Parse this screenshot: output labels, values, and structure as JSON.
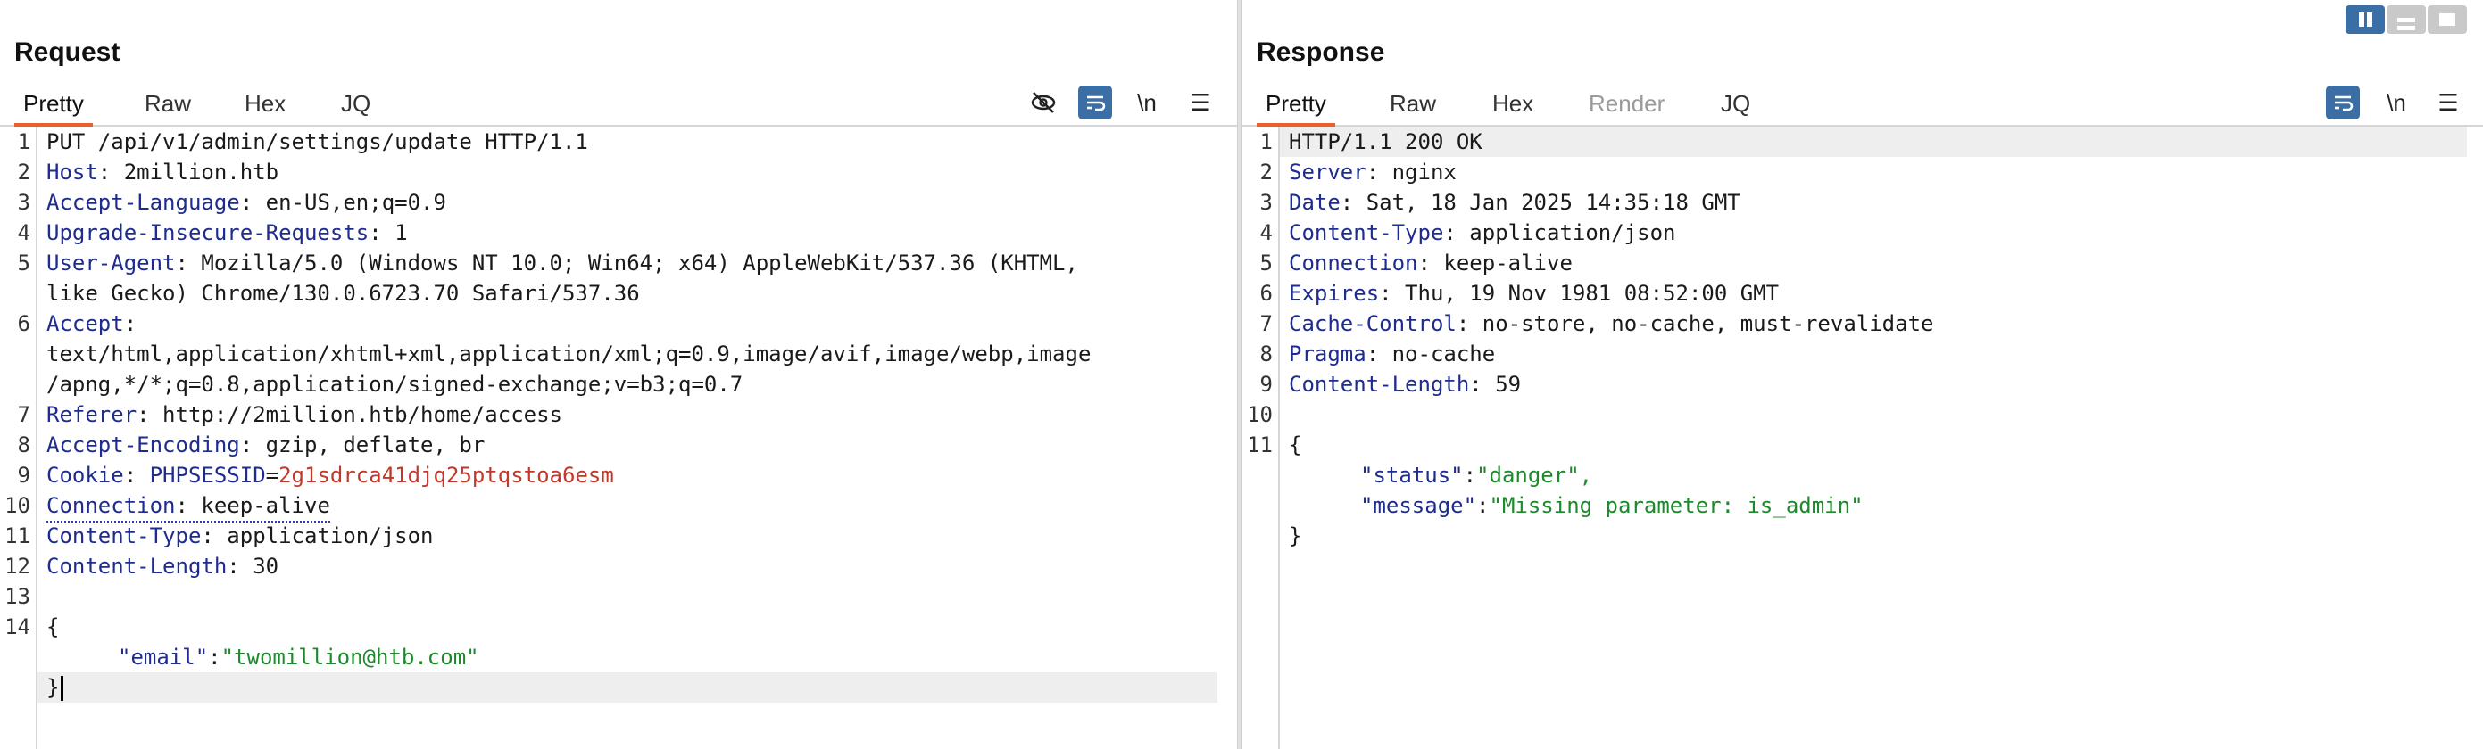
{
  "layout_buttons": [
    {
      "name": "side-by-side",
      "active": true
    },
    {
      "name": "stacked",
      "active": false
    },
    {
      "name": "single",
      "active": false
    }
  ],
  "request": {
    "title": "Request",
    "tabs": [
      "Pretty",
      "Raw",
      "Hex",
      "JQ"
    ],
    "active_tab": "Pretty",
    "tools": {
      "hide_icon": "eye-slash-icon",
      "wrap_icon": "word-wrap-icon",
      "newline": "\\n",
      "menu": "☰"
    },
    "request_line": "PUT /api/v1/admin/settings/update HTTP/1.1",
    "headers": [
      {
        "n": "2",
        "key": "Host",
        "value": " 2million.htb"
      },
      {
        "n": "3",
        "key": "Accept-Language",
        "value": " en-US,en;q=0.9"
      },
      {
        "n": "4",
        "key": "Upgrade-Insecure-Requests",
        "value": " 1"
      },
      {
        "n": "5",
        "key": "User-Agent",
        "value": " Mozilla/5.0 (Windows NT 10.0; Win64; x64) AppleWebKit/537.36 (KHTML,",
        "cont": "like Gecko) Chrome/130.0.6723.70 Safari/537.36"
      },
      {
        "n": "6",
        "key": "Accept",
        "value": "",
        "cont": "text/html,application/xhtml+xml,application/xml;q=0.9,image/avif,image/webp,image",
        "cont2": "/apng,*/*;q=0.8,application/signed-exchange;v=b3;q=0.7"
      },
      {
        "n": "7",
        "key": "Referer",
        "value": " http://2million.htb/home/access"
      },
      {
        "n": "8",
        "key": "Accept-Encoding",
        "value": " gzip, deflate, br"
      }
    ],
    "cookie": {
      "n": "9",
      "key": "Cookie",
      "name": "PHPSESSID",
      "value": "2g1sdrca41djq25ptqstoa6esm"
    },
    "headers2": [
      {
        "n": "10",
        "key": "Connection",
        "value": " keep-alive"
      },
      {
        "n": "11",
        "key": "Content-Type",
        "value": " application/json"
      },
      {
        "n": "12",
        "key": "Content-Length",
        "value": " 30"
      }
    ],
    "body_lines": {
      "blank": "13",
      "open": "14",
      "open_brace": "{",
      "key": "\"email\"",
      "colon": ":",
      "value": "\"twomillion@htb.com\"",
      "close_brace": "}"
    }
  },
  "response": {
    "title": "Response",
    "tabs": [
      "Pretty",
      "Raw",
      "Hex",
      "Render",
      "JQ"
    ],
    "active_tab": "Pretty",
    "tools": {
      "wrap_icon": "word-wrap-icon",
      "newline": "\\n",
      "menu": "☰"
    },
    "status_line": "HTTP/1.1 200 OK",
    "headers": [
      {
        "n": "2",
        "key": "Server",
        "value": " nginx"
      },
      {
        "n": "3",
        "key": "Date",
        "value": " Sat, 18 Jan 2025 14:35:18 GMT"
      },
      {
        "n": "4",
        "key": "Content-Type",
        "value": " application/json"
      },
      {
        "n": "5",
        "key": "Connection",
        "value": " keep-alive"
      },
      {
        "n": "6",
        "key": "Expires",
        "value": " Thu, 19 Nov 1981 08:52:00 GMT"
      },
      {
        "n": "7",
        "key": "Cache-Control",
        "value": " no-store, no-cache, must-revalidate"
      },
      {
        "n": "8",
        "key": "Pragma",
        "value": " no-cache"
      },
      {
        "n": "9",
        "key": "Content-Length",
        "value": " 59"
      }
    ],
    "body": {
      "blank": "10",
      "open": "11",
      "open_brace": "{",
      "k1": "\"status\"",
      "v1": "\"danger\",",
      "k2": "\"message\"",
      "v2": "\"Missing parameter: is_admin\"",
      "colon": ":",
      "close_brace": "}"
    }
  }
}
